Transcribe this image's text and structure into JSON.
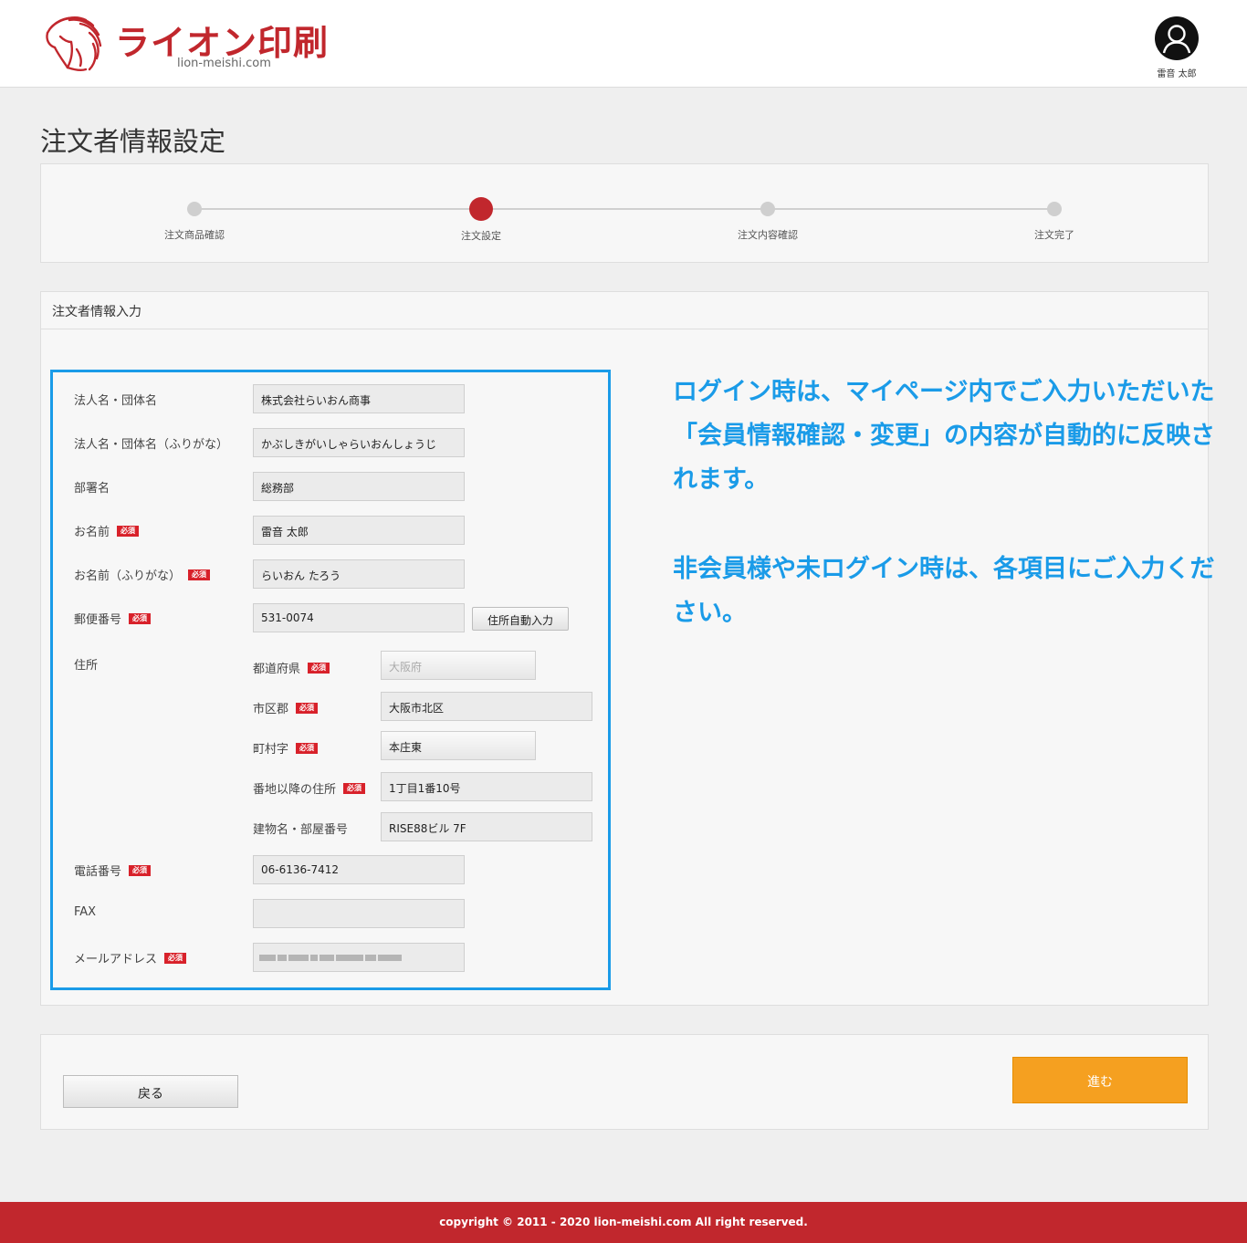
{
  "header": {
    "logo_text": "ライオン印刷",
    "logo_domain": "lion-meishi.com",
    "user_name": "雷音 太郎"
  },
  "page_title": "注文者情報設定",
  "steps": [
    {
      "label": "注文商品確認",
      "active": false
    },
    {
      "label": "注文設定",
      "active": true
    },
    {
      "label": "注文内容確認",
      "active": false
    },
    {
      "label": "注文完了",
      "active": false
    }
  ],
  "form": {
    "section_title": "注文者情報入力",
    "required_label": "必須",
    "company": {
      "label": "法人名・団体名",
      "value": "株式会社らいおん商事"
    },
    "company_kana": {
      "label": "法人名・団体名（ふりがな）",
      "value": "かぶしきがいしゃらいおんしょうじ"
    },
    "department": {
      "label": "部署名",
      "value": "総務部"
    },
    "name": {
      "label": "お名前",
      "value": "雷音 太郎"
    },
    "name_kana": {
      "label": "お名前（ふりがな）",
      "value": "らいおん たろう"
    },
    "postal": {
      "label": "郵便番号",
      "value": "531-0074",
      "button": "住所自動入力"
    },
    "address": {
      "label": "住所",
      "prefecture": {
        "label": "都道府県",
        "value": "大阪府"
      },
      "city": {
        "label": "市区郡",
        "value": "大阪市北区"
      },
      "town": {
        "label": "町村字",
        "value": "本庄東"
      },
      "street": {
        "label": "番地以降の住所",
        "value": "1丁目1番10号"
      },
      "building": {
        "label": "建物名・部屋番号",
        "value": "RISE88ビル 7F"
      }
    },
    "phone": {
      "label": "電話番号",
      "value": "06-6136-7412"
    },
    "fax": {
      "label": "FAX",
      "value": ""
    },
    "email": {
      "label": "メールアドレス",
      "value": ""
    }
  },
  "note": {
    "para1": "ログイン時は、マイページ内でご入力いただいた「会員情報確認・変更」の内容が自動的に反映されます。",
    "para2": "非会員様や未ログイン時は、各項目にご入力ください。"
  },
  "nav": {
    "back": "戻る",
    "next": "進む"
  },
  "footer": {
    "copyright": "copyright © 2011 - 2020 lion-meishi.com All right reserved."
  },
  "colors": {
    "brand": "#c1272d",
    "annotation": "#1a9be8",
    "next_button": "#f5a020"
  }
}
